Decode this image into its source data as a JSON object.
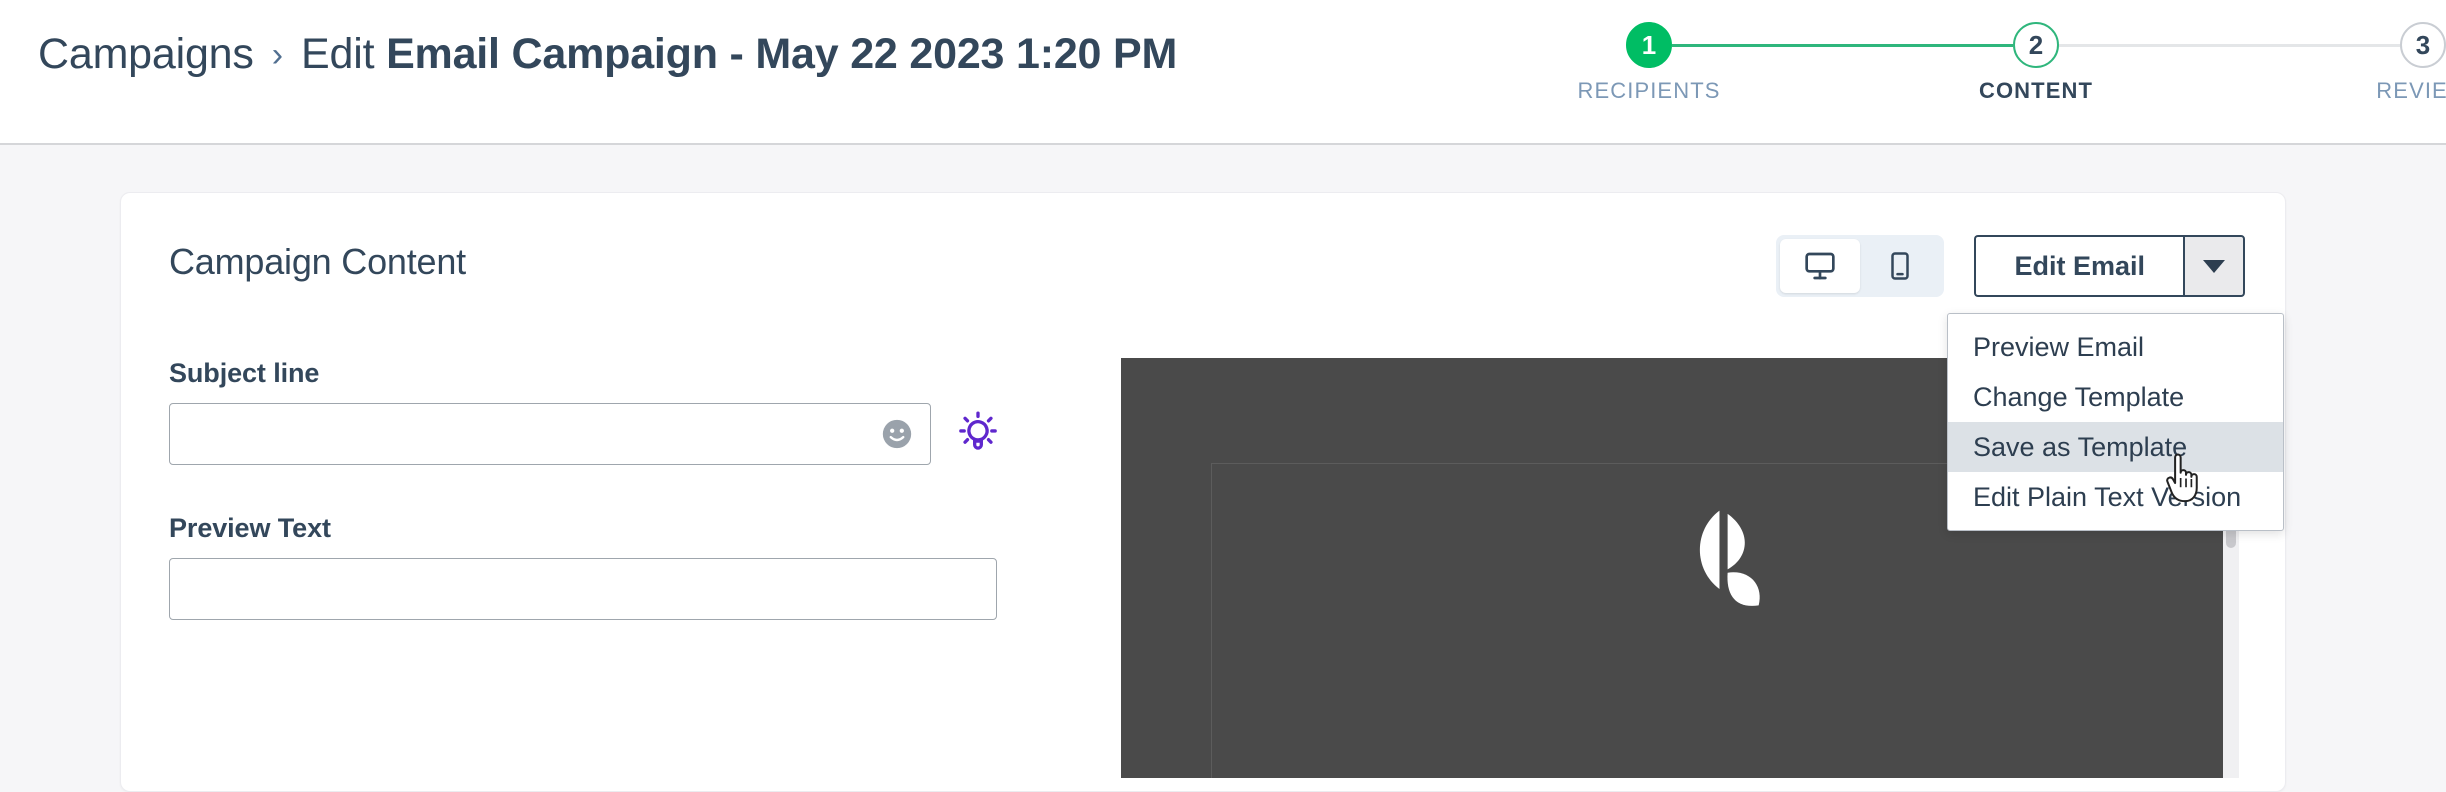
{
  "header": {
    "breadcrumb": {
      "parent": "Campaigns",
      "separator": "›",
      "action": "Edit ",
      "title": "Email Campaign - May 22 2023 1:20 PM"
    },
    "stepper": {
      "steps": [
        {
          "number": "1",
          "label": "RECIPIENTS",
          "state": "done"
        },
        {
          "number": "2",
          "label": "CONTENT",
          "state": "active"
        },
        {
          "number": "3",
          "label": "REVIEW",
          "state": "todo"
        }
      ],
      "active_color": "#2fb67c",
      "done_color": "#00bd64",
      "inactive_color": "#c9cdd3"
    }
  },
  "card": {
    "title": "Campaign Content",
    "toolbar": {
      "device_toggle": {
        "desktop_icon": "desktop-monitor-icon",
        "mobile_icon": "mobile-phone-icon",
        "selected": "desktop"
      },
      "edit_email_label": "Edit Email",
      "caret_icon": "chevron-down-icon"
    },
    "dropdown": {
      "open": true,
      "items": [
        {
          "label": "Preview Email",
          "highlighted": false
        },
        {
          "label": "Change Template",
          "highlighted": false
        },
        {
          "label": "Save as Template",
          "highlighted": true
        },
        {
          "label": "Edit Plain Text Version",
          "highlighted": false
        }
      ],
      "highlight_color": "#dce1e6"
    },
    "form": {
      "subject": {
        "label": "Subject line",
        "value": "",
        "placeholder": "",
        "emoji_icon": "emoji-smiley-icon",
        "ai_icon": "lightbulb-icon",
        "ai_icon_color": "#5f27cd"
      },
      "preview_text": {
        "label": "Preview Text",
        "value": "",
        "placeholder": ""
      }
    },
    "email_preview": {
      "background": "#4a4a4a",
      "logo_icon": "leaf-petal-logo"
    }
  },
  "cursor": {
    "icon": "pointer-hand-cursor"
  }
}
